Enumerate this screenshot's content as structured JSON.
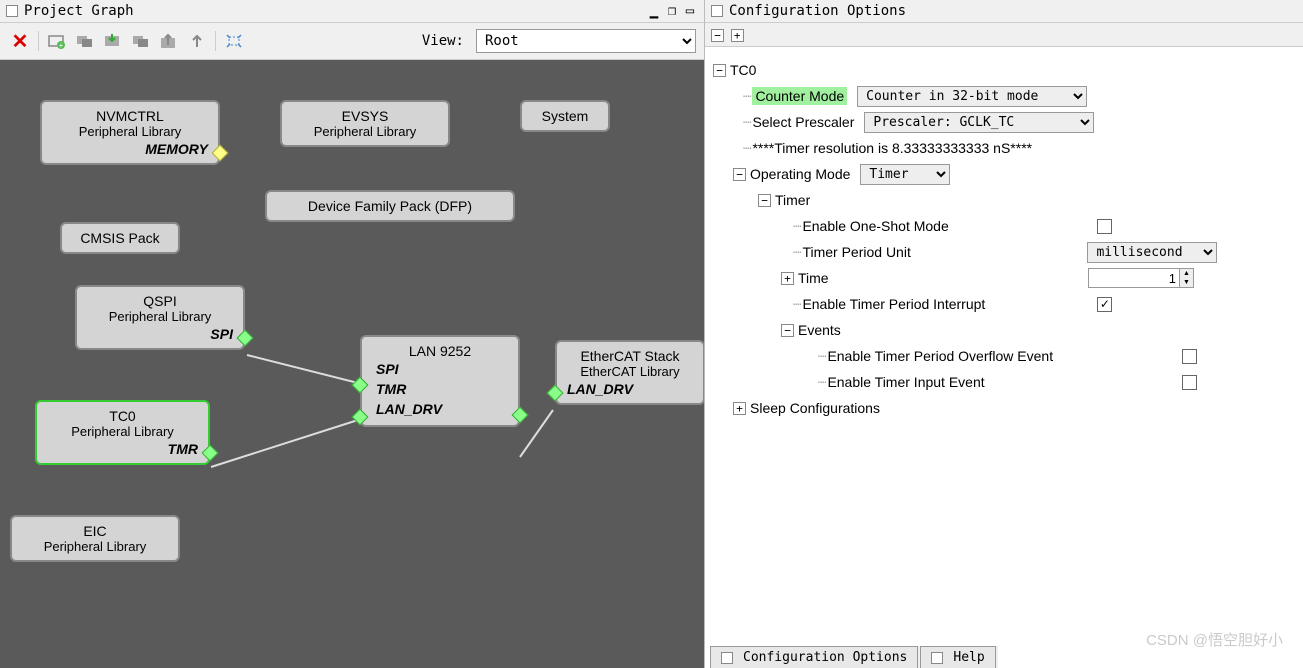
{
  "left": {
    "title": "Project Graph",
    "view_label": "View:",
    "view_value": "Root"
  },
  "nodes": {
    "nvmctrl": {
      "title": "NVMCTRL",
      "sub": "Peripheral Library",
      "role": "MEMORY"
    },
    "evsys": {
      "title": "EVSYS",
      "sub": "Peripheral Library"
    },
    "system": {
      "title": "System"
    },
    "dfp": {
      "title": "Device Family Pack (DFP)"
    },
    "cmsis": {
      "title": "CMSIS Pack"
    },
    "qspi": {
      "title": "QSPI",
      "sub": "Peripheral Library",
      "role": "SPI"
    },
    "lan": {
      "title": "LAN 9252",
      "p1": "SPI",
      "p2": "TMR",
      "p3": "LAN_DRV"
    },
    "ethercat": {
      "title": "EtherCAT Stack",
      "sub": "EtherCAT Library",
      "role": "LAN_DRV"
    },
    "tc0": {
      "title": "TC0",
      "sub": "Peripheral Library",
      "role": "TMR"
    },
    "eic": {
      "title": "EIC",
      "sub": "Peripheral Library"
    }
  },
  "right": {
    "title": "Configuration Options",
    "root": "TC0",
    "counter_mode_label": "Counter Mode",
    "counter_mode_value": "Counter in 32-bit mode",
    "prescaler_label": "Select Prescaler",
    "prescaler_value": "Prescaler: GCLK_TC",
    "resolution": "****Timer resolution is 8.33333333333 nS****",
    "opmode_label": "Operating Mode",
    "opmode_value": "Timer",
    "timer_label": "Timer",
    "oneshot_label": "Enable One-Shot Mode",
    "period_unit_label": "Timer Period Unit",
    "period_unit_value": "millisecond",
    "time_label": "Time",
    "time_value": "1",
    "interrupt_label": "Enable Timer Period Interrupt",
    "events_label": "Events",
    "overflow_label": "Enable Timer Period Overflow Event",
    "input_event_label": "Enable Timer Input Event",
    "sleep_label": "Sleep Configurations"
  },
  "tabs": {
    "config": "Configuration Options",
    "help": "Help"
  },
  "watermark": "CSDN @悟空胆好小"
}
